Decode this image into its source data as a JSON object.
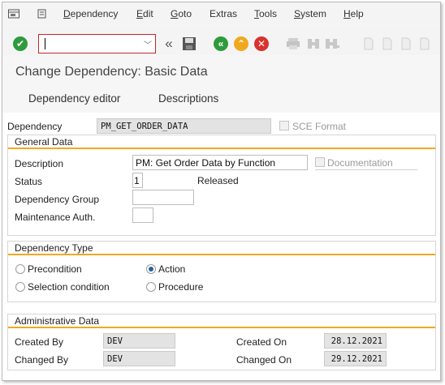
{
  "menu": {
    "items": [
      {
        "label": "Dependency",
        "underline": "D",
        "rest": "ependency"
      },
      {
        "label": "Edit",
        "underline": "E",
        "rest": "dit"
      },
      {
        "label": "Goto",
        "underline": "G",
        "rest": "oto"
      },
      {
        "label": "Extras",
        "underline": "",
        "rest": "Extras"
      },
      {
        "label": "Tools",
        "underline": "T",
        "rest": "ools"
      },
      {
        "label": "System",
        "underline": "S",
        "rest": "ystem"
      },
      {
        "label": "Help",
        "underline": "H",
        "rest": "elp"
      }
    ]
  },
  "toolbar": {
    "command_value": "",
    "icons": [
      "enter-icon",
      "command-field",
      "collapse-icon",
      "save-icon",
      "back-icon",
      "exit-icon",
      "cancel-icon",
      "print-icon",
      "find-icon",
      "find-next-icon",
      "first-page-icon",
      "prev-page-icon",
      "next-page-icon",
      "last-page-icon"
    ]
  },
  "page": {
    "title": "Change Dependency: Basic Data"
  },
  "tabs": [
    "Dependency editor",
    "Descriptions"
  ],
  "header": {
    "dependency_label": "Dependency",
    "dependency_value": "PM_GET_ORDER_DATA",
    "sce_format_label": "SCE Format"
  },
  "general_data": {
    "title": "General Data",
    "description_label": "Description",
    "description_value": "PM: Get Order Data by Function",
    "documentation_label": "Documentation",
    "status_label": "Status",
    "status_value": "1",
    "status_text": "Released",
    "dependency_group_label": "Dependency Group",
    "dependency_group_value": "",
    "maintenance_auth_label": "Maintenance Auth.",
    "maintenance_auth_value": ""
  },
  "dependency_type": {
    "title": "Dependency Type",
    "options": [
      {
        "label": "Precondition",
        "selected": false
      },
      {
        "label": "Action",
        "selected": true
      },
      {
        "label": "Selection condition",
        "selected": false
      },
      {
        "label": "Procedure",
        "selected": false
      }
    ]
  },
  "admin_data": {
    "title": "Administrative Data",
    "created_by_label": "Created By",
    "created_by_value": "DEV",
    "changed_by_label": "Changed By",
    "changed_by_value": "DEV",
    "created_on_label": "Created On",
    "created_on_value": "28.12.2021",
    "changed_on_label": "Changed On",
    "changed_on_value": "29.12.2021"
  },
  "colors": {
    "accent_orange": "#f0a91e",
    "green": "#2e9b3c",
    "red": "#d8332e",
    "field_ro": "#e3e3e3"
  }
}
